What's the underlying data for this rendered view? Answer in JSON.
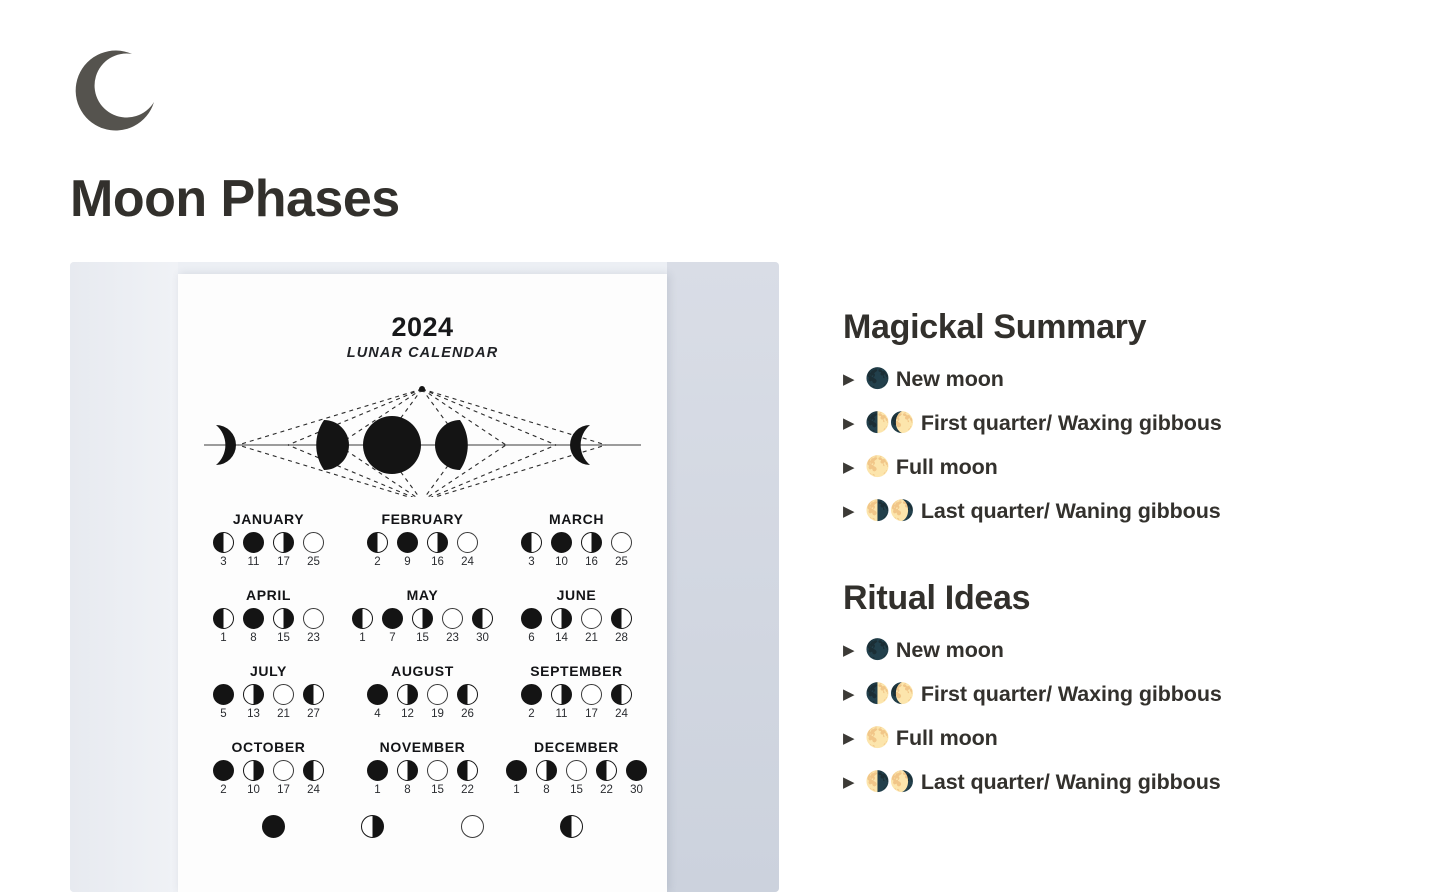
{
  "page": {
    "icon": "crescent-moon-icon",
    "title": "Moon Phases",
    "background": "#ffffff",
    "title_color": "#32302c"
  },
  "cover_image": {
    "name": "lunar-calendar-poster",
    "year": "2024",
    "subtitle": "LUNAR CALENDAR",
    "diagram": "moon-phase-cycle-diagram",
    "months": [
      [
        {
          "name": "JANUARY",
          "phases": [
            "last",
            "new",
            "first",
            "full"
          ],
          "days": [
            "3",
            "11",
            "17",
            "25"
          ]
        },
        {
          "name": "FEBRUARY",
          "phases": [
            "last",
            "new",
            "first",
            "full"
          ],
          "days": [
            "2",
            "9",
            "16",
            "24"
          ]
        },
        {
          "name": "MARCH",
          "phases": [
            "last",
            "new",
            "first",
            "full"
          ],
          "days": [
            "3",
            "10",
            "16",
            "25"
          ]
        }
      ],
      [
        {
          "name": "APRIL",
          "phases": [
            "last",
            "new",
            "first",
            "full"
          ],
          "days": [
            "1",
            "8",
            "15",
            "23"
          ]
        },
        {
          "name": "MAY",
          "phases": [
            "last",
            "new",
            "first",
            "full",
            "last"
          ],
          "days": [
            "1",
            "7",
            "15",
            "23",
            "30"
          ]
        },
        {
          "name": "JUNE",
          "phases": [
            "new",
            "first",
            "full",
            "last"
          ],
          "days": [
            "6",
            "14",
            "21",
            "28"
          ]
        }
      ],
      [
        {
          "name": "JULY",
          "phases": [
            "new",
            "first",
            "full",
            "last"
          ],
          "days": [
            "5",
            "13",
            "21",
            "27"
          ]
        },
        {
          "name": "AUGUST",
          "phases": [
            "new",
            "first",
            "full",
            "last"
          ],
          "days": [
            "4",
            "12",
            "19",
            "26"
          ]
        },
        {
          "name": "SEPTEMBER",
          "phases": [
            "new",
            "first",
            "full",
            "last"
          ],
          "days": [
            "2",
            "11",
            "17",
            "24"
          ]
        }
      ],
      [
        {
          "name": "OCTOBER",
          "phases": [
            "new",
            "first",
            "full",
            "last"
          ],
          "days": [
            "2",
            "10",
            "17",
            "24"
          ]
        },
        {
          "name": "NOVEMBER",
          "phases": [
            "new",
            "first",
            "full",
            "last"
          ],
          "days": [
            "1",
            "8",
            "15",
            "22"
          ]
        },
        {
          "name": "DECEMBER",
          "phases": [
            "new",
            "first",
            "full",
            "last",
            "new"
          ],
          "days": [
            "1",
            "8",
            "15",
            "22",
            "30"
          ]
        }
      ]
    ],
    "legend_phases": [
      "new",
      "first",
      "full",
      "last"
    ],
    "sheet_color": "#fdfdfd",
    "backdrop_color": "#e6eaf1"
  },
  "sections": [
    {
      "heading": "Magickal Summary",
      "items": [
        {
          "toggle": "▶",
          "emoji": "🌑",
          "emoji_name": "new-moon-emoji",
          "label": "New moon"
        },
        {
          "toggle": "▶",
          "emoji": "🌓🌔",
          "emoji_name": "first-quarter-waxing-gibbous-emoji",
          "label": "First quarter/ Waxing gibbous"
        },
        {
          "toggle": "▶",
          "emoji": "🌕",
          "emoji_name": "full-moon-emoji",
          "label": "Full moon"
        },
        {
          "toggle": "▶",
          "emoji": "🌗🌖",
          "emoji_name": "last-quarter-waning-gibbous-emoji",
          "label": "Last quarter/ Waning gibbous"
        }
      ]
    },
    {
      "heading": "Ritual Ideas",
      "items": [
        {
          "toggle": "▶",
          "emoji": "🌑",
          "emoji_name": "new-moon-emoji",
          "label": "New moon"
        },
        {
          "toggle": "▶",
          "emoji": "🌓🌔",
          "emoji_name": "first-quarter-waxing-gibbous-emoji",
          "label": "First quarter/ Waxing gibbous"
        },
        {
          "toggle": "▶",
          "emoji": "🌕",
          "emoji_name": "full-moon-emoji",
          "label": "Full moon"
        },
        {
          "toggle": "▶",
          "emoji": "🌗🌖",
          "emoji_name": "last-quarter-waning-gibbous-emoji",
          "label": "Last quarter/ Waning gibbous"
        }
      ]
    }
  ]
}
